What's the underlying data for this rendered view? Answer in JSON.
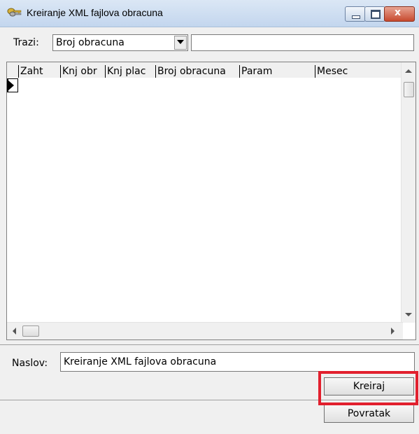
{
  "window": {
    "title": "Kreiranje XML fajlova obracuna",
    "close_symbol": "x"
  },
  "search": {
    "label": "Trazi:",
    "selected": "Broj obracuna",
    "query": ""
  },
  "grid": {
    "columns": [
      "Zaht",
      "Knj obr",
      "Knj plac",
      "Broj obracuna",
      "Param",
      "Mesec"
    ],
    "rows": []
  },
  "naslov": {
    "label": "Naslov:",
    "value": "Kreiranje XML fajlova obracuna"
  },
  "buttons": {
    "create": "Kreiraj",
    "back": "Povratak"
  },
  "colors": {
    "highlight": "#e2202e"
  }
}
